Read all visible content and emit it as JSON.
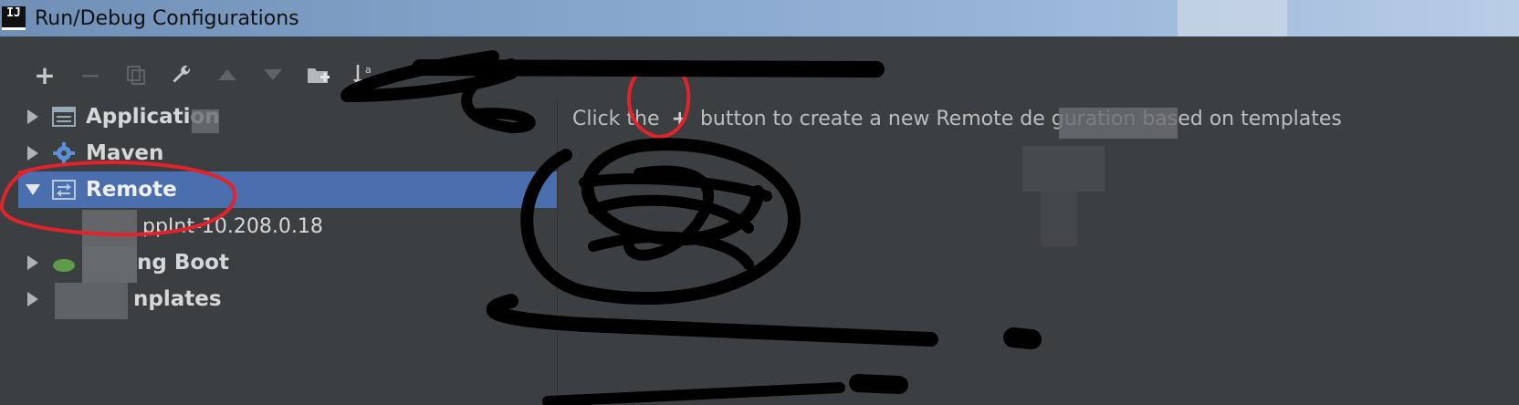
{
  "window": {
    "title": "Run/Debug Configurations",
    "logo_text": "IJ"
  },
  "toolbar": {
    "add": "+",
    "remove": "−"
  },
  "tree": {
    "items": [
      {
        "label": "Application",
        "expanded": false,
        "icon": "application-icon"
      },
      {
        "label": "Maven",
        "expanded": false,
        "icon": "gear-icon"
      },
      {
        "label": "Remote",
        "expanded": true,
        "selected": true,
        "icon": "remote-icon"
      },
      {
        "label": "ppInt-10.208.0.18",
        "child": true
      },
      {
        "label": "ng Boot",
        "expanded": false,
        "icon": "spring-boot-icon"
      },
      {
        "label": "nplates",
        "expanded": false,
        "icon": "templates-icon"
      }
    ]
  },
  "hint": {
    "prefix": "Click the",
    "plus": "+",
    "suffix": "button to create a new Remote de          guration based on templates"
  },
  "colors": {
    "background": "#3c3f41",
    "selection": "#4b6eaf",
    "annotation_red": "#e3232b"
  }
}
